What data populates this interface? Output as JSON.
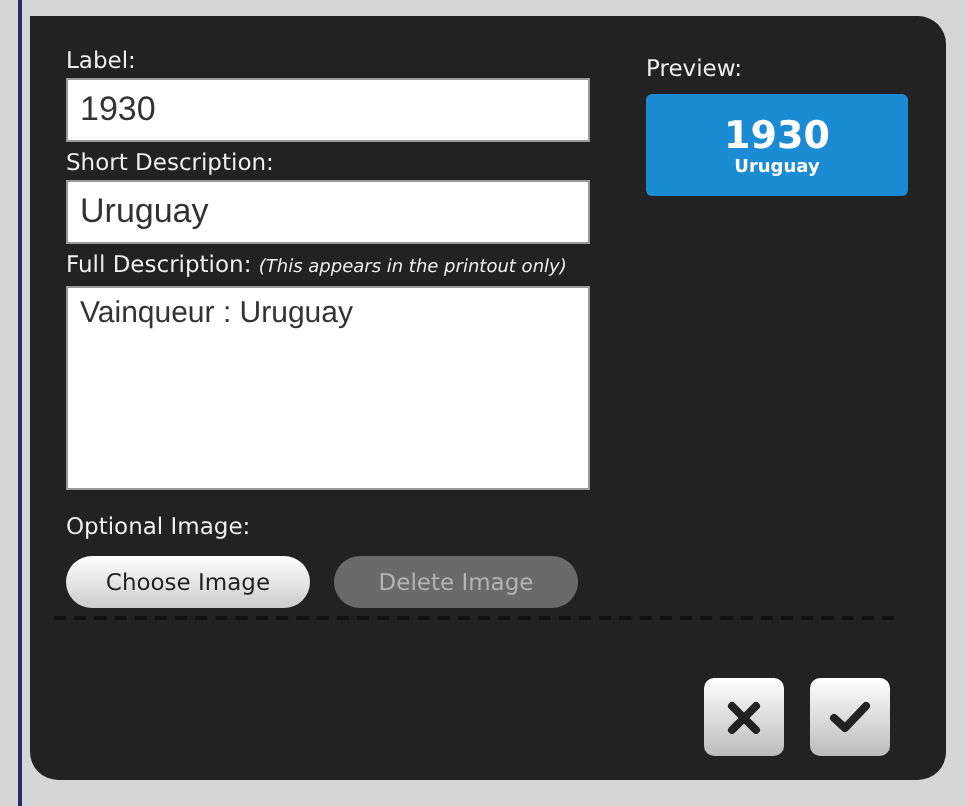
{
  "fields": [
    {
      "label": "Label:",
      "value": "1930",
      "kind": "input"
    },
    {
      "label": "Short Description:",
      "value": "Uruguay",
      "kind": "input"
    },
    {
      "label": "Full Description:",
      "note": "(This appears in the printout only)",
      "value": "Vainqueur : Uruguay",
      "kind": "textarea"
    }
  ],
  "image": {
    "label": "Optional Image:",
    "buttons": [
      {
        "label": "Choose Image",
        "disabled": false
      },
      {
        "label": "Delete Image",
        "disabled": true
      }
    ]
  },
  "preview": {
    "label": "Preview:",
    "title": "1930",
    "subtitle": "Uruguay"
  }
}
